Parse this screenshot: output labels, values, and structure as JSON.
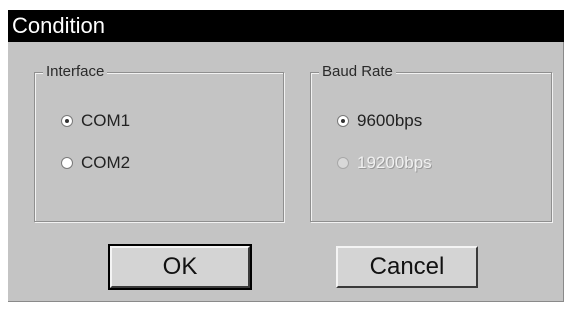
{
  "window": {
    "title": "Condition"
  },
  "interface_group": {
    "label": "Interface",
    "options": [
      {
        "label": "COM1",
        "selected": true,
        "enabled": true
      },
      {
        "label": "COM2",
        "selected": false,
        "enabled": true
      }
    ]
  },
  "baud_group": {
    "label": "Baud Rate",
    "options": [
      {
        "label": "9600bps",
        "selected": true,
        "enabled": true
      },
      {
        "label": "19200bps",
        "selected": false,
        "enabled": false
      }
    ]
  },
  "buttons": {
    "ok_label": "OK",
    "cancel_label": "Cancel"
  }
}
